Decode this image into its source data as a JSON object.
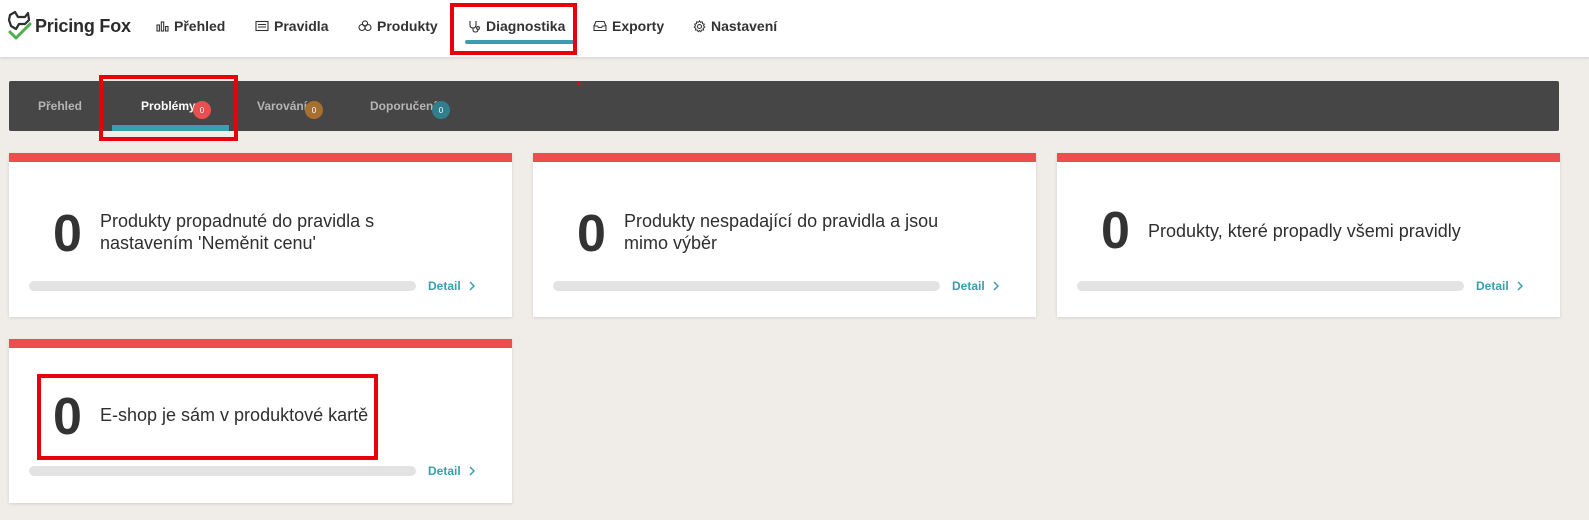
{
  "app": {
    "name": "Pricing Fox"
  },
  "nav": [
    {
      "label": "Přehled",
      "icon": "bar-chart-icon"
    },
    {
      "label": "Pravidla",
      "icon": "rules-icon"
    },
    {
      "label": "Produkty",
      "icon": "products-icon"
    },
    {
      "label": "Diagnostika",
      "icon": "stethoscope-icon",
      "active": true
    },
    {
      "label": "Exporty",
      "icon": "inbox-icon"
    },
    {
      "label": "Nastavení",
      "icon": "gear-icon"
    }
  ],
  "subtabs": [
    {
      "label": "Přehled"
    },
    {
      "label": "Problémy",
      "badge": "0",
      "badge_color": "#ea4f4f",
      "active": true
    },
    {
      "label": "Varování",
      "badge": "0",
      "badge_color": "#a8702f"
    },
    {
      "label": "Doporučení",
      "badge": "0",
      "badge_color": "#2f7f8c"
    }
  ],
  "cards": [
    {
      "count": "0",
      "text": "Produkty propadnuté do pravidla s nastavením 'Neměnit cenu'",
      "progress": 0,
      "detail": "Detail"
    },
    {
      "count": "0",
      "text": "Produkty nespadající do pravidla a jsou mimo výběr",
      "progress": 0,
      "detail": "Detail"
    },
    {
      "count": "0",
      "text": "Produkty, které propadly všemi pravidly",
      "progress": 0,
      "detail": "Detail"
    },
    {
      "count": "0",
      "text": "E-shop je sám v produktové kartě",
      "progress": 0,
      "detail": "Detail"
    }
  ],
  "colors": {
    "accent": "#3a9eae",
    "danger": "#ea4f4f",
    "subtab_bar": "#464646",
    "highlight": "#e8000b"
  }
}
